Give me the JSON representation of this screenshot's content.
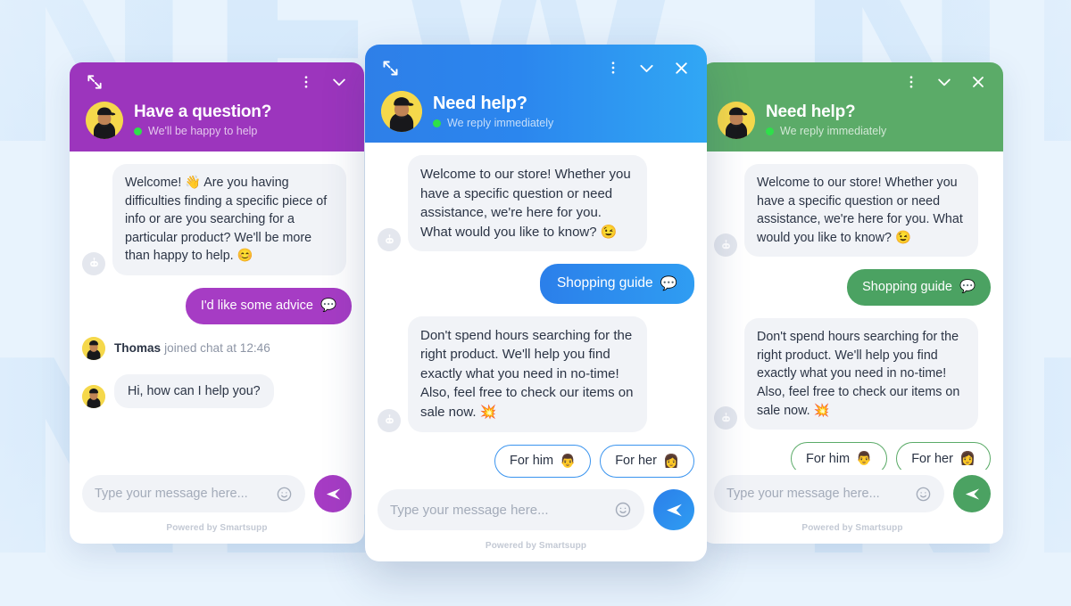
{
  "background": {
    "watermark_text": "NEW NEW",
    "watermark_color": "#cfe6fa",
    "page_color": "#e8f3fd"
  },
  "widgets": [
    {
      "id": "purple",
      "accent": "#9c35bd",
      "bubble_accent": "#a63cc4",
      "header": {
        "title": "Have a question?",
        "status": "We'll be happy to help",
        "expand_icon": "expand-arrows-icon",
        "menu_icon": "kebab-menu-icon",
        "minimize_icon": "chevron-down-icon"
      },
      "messages": [
        {
          "from": "bot",
          "text": "Welcome! 👋 Are you having difficulties finding a specific piece of info or are you searching for a particular product? We'll be more than happy to help. 😊"
        },
        {
          "from": "user",
          "text": "I'd like some advice",
          "emoji": "💬"
        },
        {
          "from": "system",
          "name": "Thomas",
          "text": "joined chat at 12:46"
        },
        {
          "from": "agent",
          "text": "Hi, how can I help you?"
        }
      ],
      "composer": {
        "placeholder": "Type your message here...",
        "value": "",
        "emoji_icon": "smiley-icon",
        "send_icon": "send-paper-plane-icon"
      },
      "footer": "Powered by Smartsupp"
    },
    {
      "id": "blue",
      "accent": "#2b86ee",
      "bubble_accent": "#2f9df2",
      "header": {
        "title": "Need help?",
        "status": "We reply immediately",
        "expand_icon": "expand-arrows-icon",
        "menu_icon": "kebab-menu-icon",
        "minimize_icon": "chevron-down-icon",
        "close_icon": "close-x-icon"
      },
      "messages": [
        {
          "from": "bot",
          "text": "Welcome to our store! Whether you have a specific question or need assistance, we're here for you. What would you like to know? 😉"
        },
        {
          "from": "user",
          "text": "Shopping guide",
          "emoji": "💬"
        },
        {
          "from": "bot",
          "text": "Don't spend hours searching for the right product. We'll help you find exactly what you need in no-time! Also, feel free to check our items on sale now. 💥"
        }
      ],
      "quick_replies": [
        {
          "label": "For him",
          "emoji": "👨"
        },
        {
          "label": "For her",
          "emoji": "👩"
        }
      ],
      "composer": {
        "placeholder": "Type your message here...",
        "value": "",
        "emoji_icon": "smiley-icon",
        "send_icon": "send-paper-plane-icon"
      },
      "footer": "Powered by Smartsupp"
    },
    {
      "id": "green",
      "accent": "#5bab68",
      "bubble_accent": "#4ba262",
      "header": {
        "title": "Need help?",
        "status": "We reply immediately",
        "menu_icon": "kebab-menu-icon",
        "minimize_icon": "chevron-down-icon",
        "close_icon": "close-x-icon"
      },
      "messages": [
        {
          "from": "bot",
          "text": "Welcome to our store! Whether you have a specific question or need assistance, we're here for you. What would you like to know? 😉"
        },
        {
          "from": "user",
          "text": "Shopping guide",
          "emoji": "💬"
        },
        {
          "from": "bot",
          "text": "Don't spend hours searching for the right product. We'll help you find exactly what you need in no-time! Also, feel free to check our items on sale now. 💥"
        }
      ],
      "quick_replies": [
        {
          "label": "For him",
          "emoji": "👨"
        },
        {
          "label": "For her",
          "emoji": "👩"
        }
      ],
      "composer": {
        "placeholder": "Type your message here...",
        "value": "",
        "emoji_icon": "smiley-icon",
        "send_icon": "send-paper-plane-icon"
      },
      "footer": "Powered by Smartsupp"
    }
  ]
}
